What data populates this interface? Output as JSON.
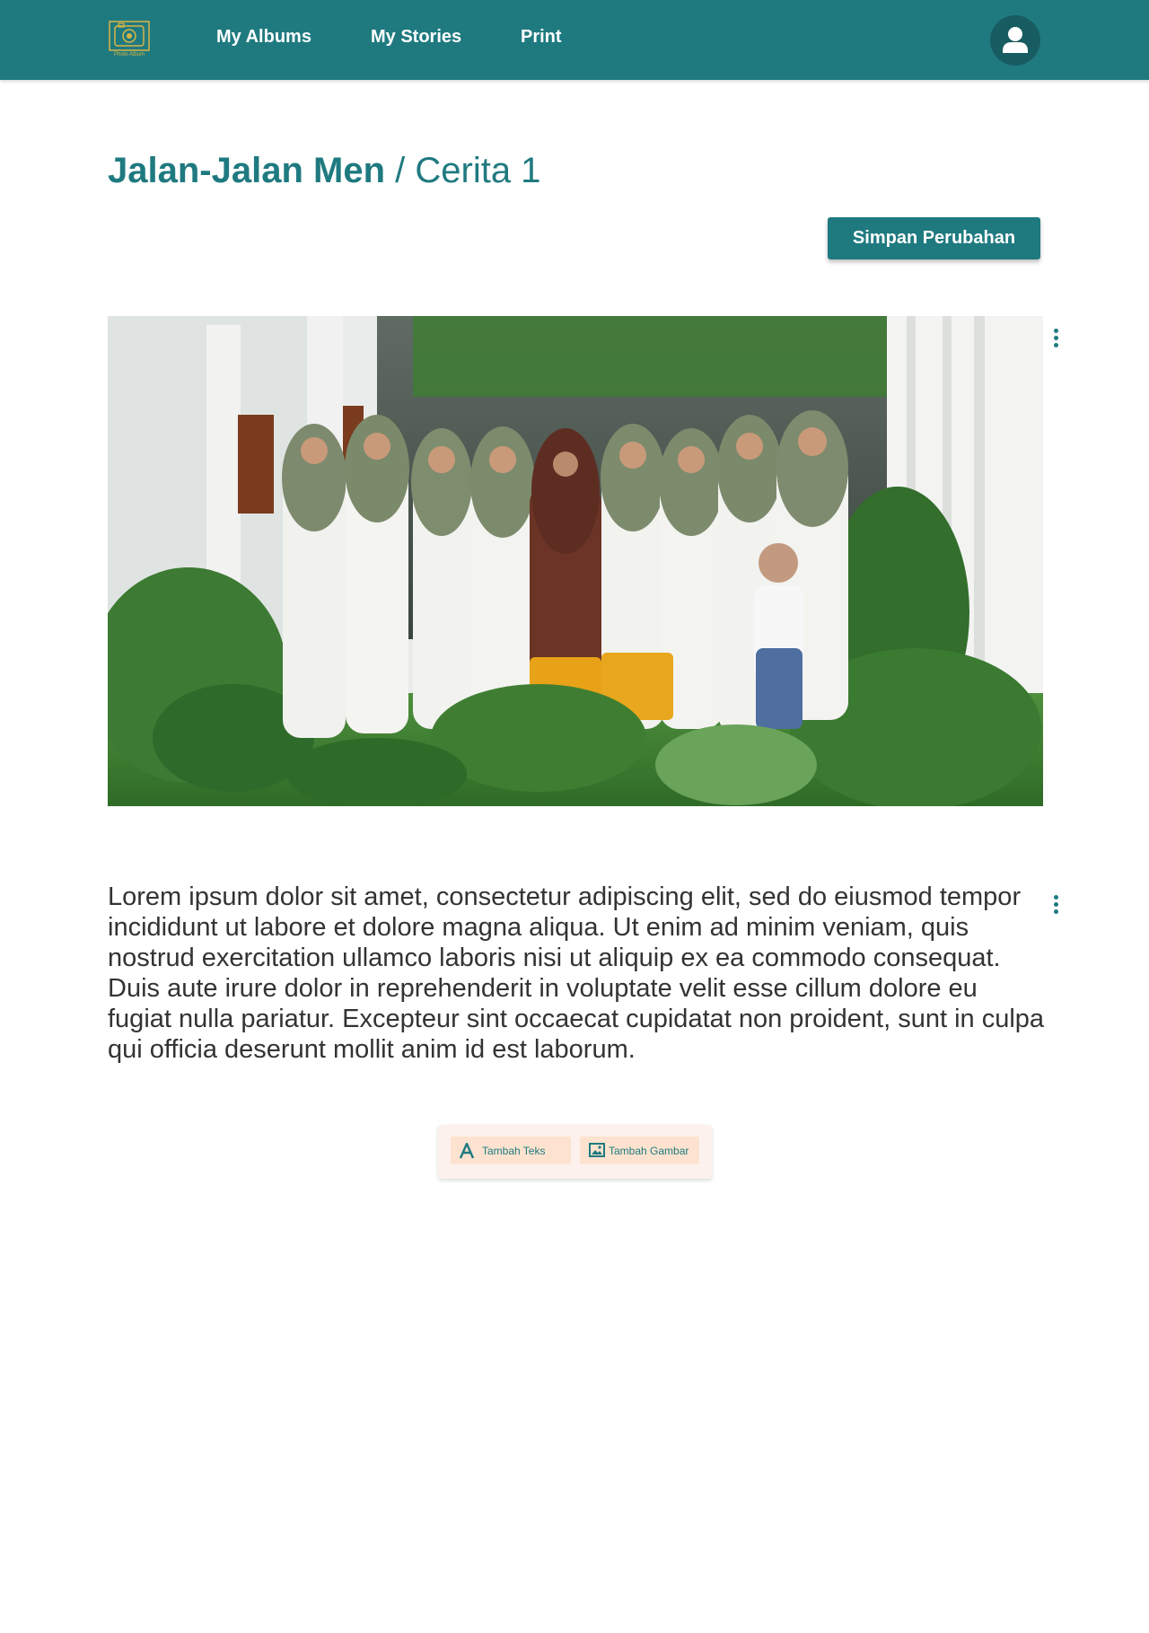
{
  "app": {
    "logo_text": "Photo Album",
    "colors": {
      "primary": "#1f7a80",
      "toolbar_bg": "#fdf1ee",
      "tool_button_bg": "#fde3cf"
    }
  },
  "nav": {
    "items": [
      {
        "label": "My Albums"
      },
      {
        "label": "My Stories"
      },
      {
        "label": "Print"
      }
    ],
    "profile_icon": "user-icon"
  },
  "page": {
    "album_name": "Jalan-Jalan Men",
    "separator": " / ",
    "story_name": "Cerita 1"
  },
  "actions": {
    "save_label": "Simpan Perubahan"
  },
  "story": {
    "text": "Lorem ipsum dolor sit amet, consectetur adipiscing elit, sed do eiusmod tempor incididunt ut labore et dolore magna aliqua. Ut enim ad minim veniam, quis nostrud exercitation ullamco laboris nisi ut aliquip ex ea commodo consequat. Duis aute irure dolor in reprehenderit in voluptate velit esse cillum dolore eu fugiat nulla pariatur. Excepteur sint occaecat cupidatat non proident, sunt in culpa qui officia deserunt mollit anim id est laborum."
  },
  "toolbar": {
    "add_text_label": "Tambah Teks",
    "add_image_label": "Tambah Gambar"
  }
}
